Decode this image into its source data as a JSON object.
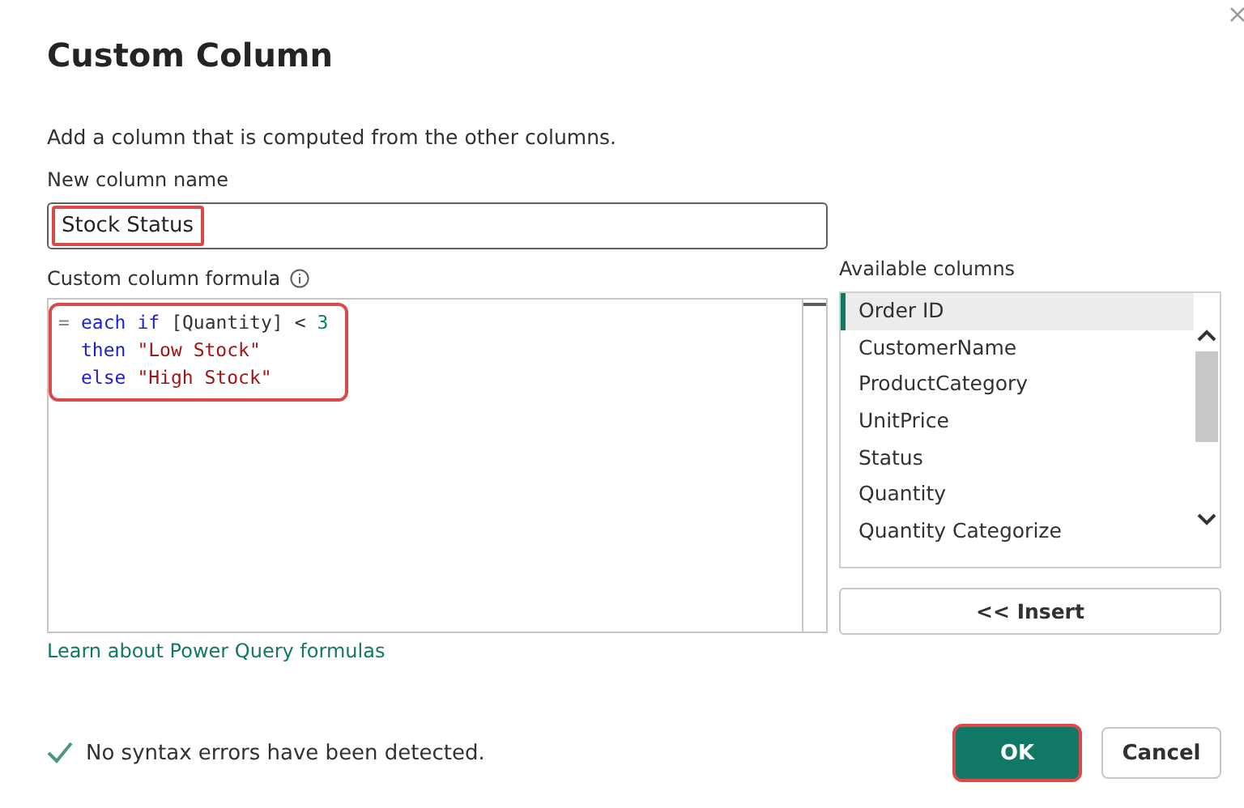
{
  "dialog": {
    "title": "Custom Column",
    "description": "Add a column that is computed from the other columns."
  },
  "column_name": {
    "label": "New column name",
    "value": "Stock Status",
    "highlighted": true
  },
  "formula": {
    "label": "Custom column formula",
    "highlighted": true,
    "lines": [
      [
        {
          "text": "=",
          "kind": "prefix"
        },
        {
          "text": "each",
          "kind": "keyword"
        },
        {
          "text": "if",
          "kind": "keyword"
        },
        {
          "text": "[Quantity]",
          "kind": "field"
        },
        {
          "text": "<",
          "kind": "operator"
        },
        {
          "text": "3",
          "kind": "number"
        }
      ],
      [
        {
          "text": "then",
          "kind": "keyword"
        },
        {
          "text": "\"Low Stock\"",
          "kind": "string"
        }
      ],
      [
        {
          "text": "else",
          "kind": "keyword"
        },
        {
          "text": "\"High Stock\"",
          "kind": "string"
        }
      ]
    ]
  },
  "available_columns": {
    "label": "Available columns",
    "items": [
      {
        "name": "Order ID",
        "selected": true
      },
      {
        "name": "CustomerName",
        "selected": false
      },
      {
        "name": "ProductCategory",
        "selected": false
      },
      {
        "name": "UnitPrice",
        "selected": false
      },
      {
        "name": "Status",
        "selected": false
      },
      {
        "name": "Quantity",
        "selected": false
      },
      {
        "name": "Quantity Categorize",
        "selected": false
      }
    ],
    "insert_button": "<< Insert"
  },
  "learn_link": "Learn about Power Query formulas",
  "status": {
    "ok": true,
    "message": "No syntax errors have been detected."
  },
  "buttons": [
    {
      "label": "OK",
      "kind": "primary",
      "highlighted": true
    },
    {
      "label": "Cancel",
      "kind": "secondary",
      "highlighted": false
    }
  ]
}
